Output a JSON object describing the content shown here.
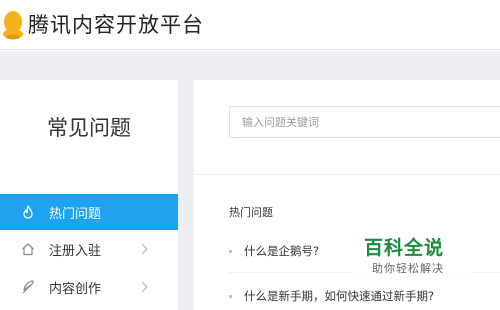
{
  "header": {
    "brand": "腾讯内容开放平台",
    "logo_icon": "penguin-logo-icon"
  },
  "sidebar": {
    "title": "常见问题",
    "items": [
      {
        "label": "热门问题",
        "icon": "flame-icon",
        "active": true
      },
      {
        "label": "注册入驻",
        "icon": "home-icon",
        "active": false
      },
      {
        "label": "内容创作",
        "icon": "feather-icon",
        "active": false
      }
    ]
  },
  "main": {
    "search_placeholder": "输入问题关键词",
    "section_title": "热门问题",
    "faq": [
      "什么是企鹅号?",
      "什么是新手期，如何快速通过新手期?"
    ]
  },
  "watermark": {
    "title": "百科全说",
    "subtitle": "助你轻松解决"
  },
  "colors": {
    "accent": "#1fa3ef",
    "band": "#eceef1",
    "logo": "#f5b21b",
    "watermark": "#1c8b3d"
  }
}
